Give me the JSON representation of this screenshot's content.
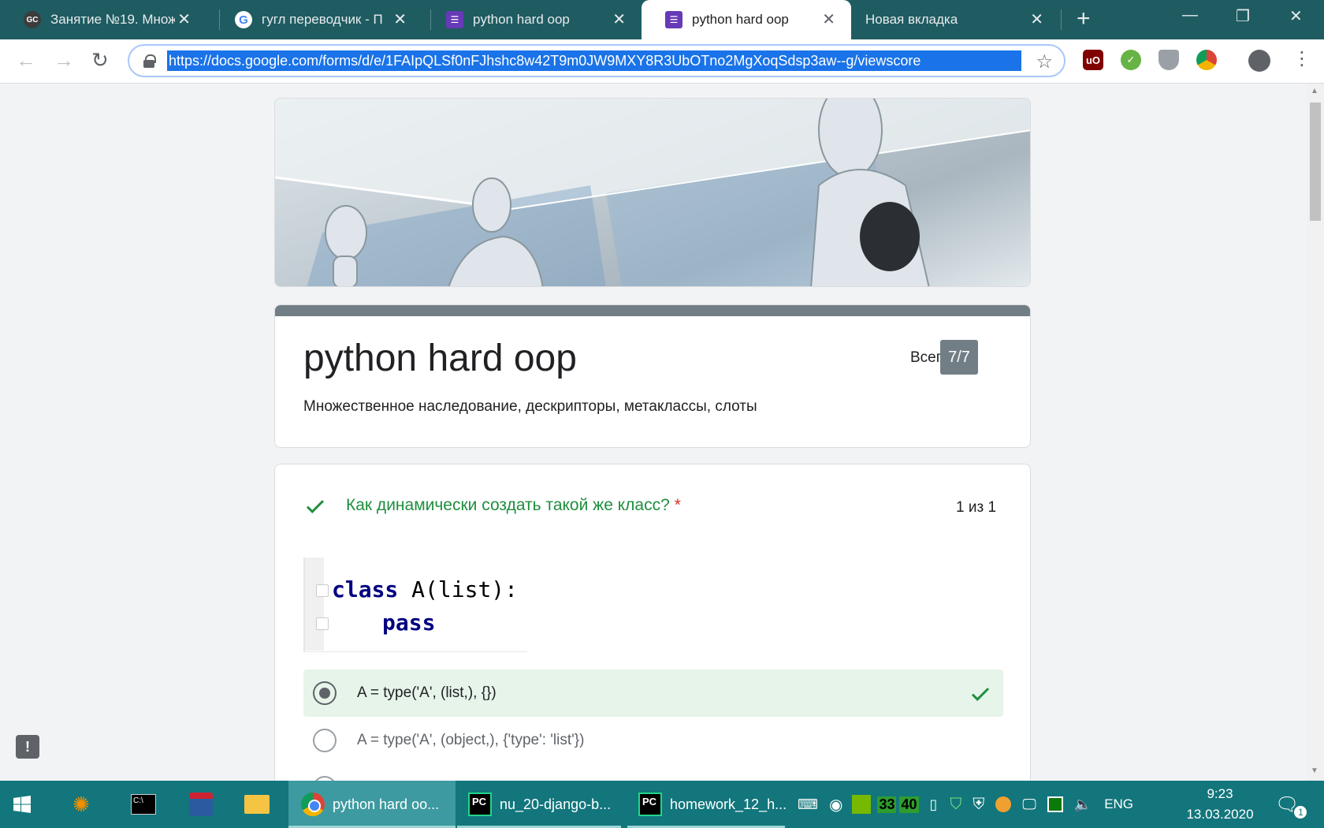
{
  "browser": {
    "tabs": [
      {
        "title": "Занятие №19. Множ",
        "favicon": "gc-logo-icon",
        "active": false
      },
      {
        "title": "гугл переводчик - П",
        "favicon": "google-icon",
        "active": false
      },
      {
        "title": "python hard oop",
        "favicon": "google-forms-icon",
        "active": false
      },
      {
        "title": "python hard oop",
        "favicon": "google-forms-icon",
        "active": true
      },
      {
        "title": "Новая вкладка",
        "favicon": "",
        "active": false
      }
    ],
    "new_tab_symbol": "+",
    "url": "https://docs.google.com/forms/d/e/1FAIpQLSf0nFJhshc8w42T9m0JW9MXY8R3UbOTno2MgXoqSdsp3aw--g/viewscore",
    "extensions": [
      {
        "name": "ublock-origin-icon",
        "label": "uO",
        "color": "#800000"
      },
      {
        "name": "adguard-check-icon",
        "label": "✓",
        "color": "#67b346"
      },
      {
        "name": "shield-extension-icon",
        "label": "",
        "color": "#9aa0a6"
      },
      {
        "name": "chrome-extension-icon",
        "label": "",
        "color": "#4285f4"
      }
    ]
  },
  "form": {
    "title": "python hard oop",
    "description": "Множественное наследование, дескрипторы, метаклассы, слоты",
    "score_label": "Всего",
    "score": "7/7",
    "accent_color": "#727e85"
  },
  "question": {
    "text": "Как динамически создать такой же класс?",
    "required_mark": "*",
    "points": "1 из 1",
    "status_color": "#1e8e3e",
    "code": {
      "line1_kw": "class",
      "line1_rest": " A(list):",
      "line2_kw": "pass"
    },
    "options": [
      {
        "label": "A = type('A', (list,), {})",
        "selected": true,
        "correct": true
      },
      {
        "label": "A = type('A', (object,), {'type': 'list'})",
        "selected": false,
        "correct": false
      }
    ]
  },
  "taskbar": {
    "apps": [
      {
        "name": "python hard oo...",
        "icon": "chrome-icon",
        "active": true
      },
      {
        "name": "nu_20-django-b...",
        "icon": "pycharm-icon",
        "active": false
      },
      {
        "name": "homework_12_h...",
        "icon": "pycharm-icon",
        "active": false
      }
    ],
    "tray_numbers": [
      "33",
      "40"
    ],
    "language": "ENG",
    "time": "9:23",
    "date": "13.03.2020",
    "notification_count": "1"
  }
}
